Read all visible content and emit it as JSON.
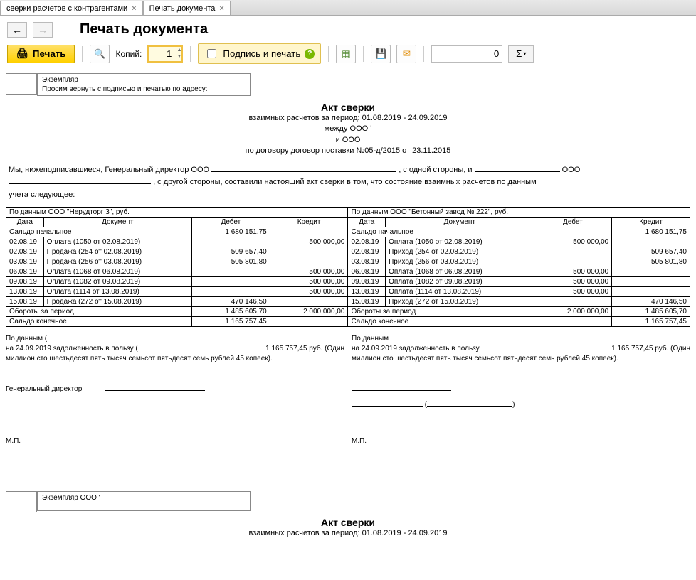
{
  "tabs": [
    {
      "label": "сверки расчетов с контрагентами"
    },
    {
      "label": "Печать документа"
    }
  ],
  "page_title": "Печать документа",
  "toolbar": {
    "print_label": "Печать",
    "copies_label": "Копий:",
    "copies_value": "1",
    "sign_print_label": "Подпись и печать",
    "number_value": "0"
  },
  "small_box": {
    "line1": "Экземпляр",
    "line2": "Просим вернуть с подписью и печатью по адресу:"
  },
  "doc": {
    "title": "Акт сверки",
    "period": "взаимных расчетов за период: 01.08.2019 - 24.09.2019",
    "between": "между ООО '",
    "and": "и ООО",
    "contract": "по договору договор поставки №05-д/2015 от 23.11.2015"
  },
  "intro": {
    "t1": "Мы, нижеподписавшиеся, Генеральный директор ООО",
    "t2": ", с одной стороны, и ",
    "t3": " ООО",
    "t4": ", с другой стороны, составили настоящий акт сверки в том, что состояние взаимных расчетов по данным",
    "t5": "учета следующее:"
  },
  "table": {
    "left_header": "По данным ООО \"Нерудторг 3\", руб.",
    "right_header": "По данным ООО \"Бетонный завод № 222\", руб.",
    "cols": {
      "date": "Дата",
      "doc": "Документ",
      "debit": "Дебет",
      "credit": "Кредит"
    },
    "open": "Сальдо начальное",
    "open_val": "1 680 151,75",
    "rows_left": [
      {
        "d": "02.08.19",
        "doc": "Оплата (1050 от 02.08.2019)",
        "db": "",
        "cr": "500 000,00"
      },
      {
        "d": "02.08.19",
        "doc": "Продажа (254 от 02.08.2019)",
        "db": "509 657,40",
        "cr": ""
      },
      {
        "d": "03.08.19",
        "doc": "Продажа (256 от 03.08.2019)",
        "db": "505 801,80",
        "cr": ""
      },
      {
        "d": "06.08.19",
        "doc": "Оплата (1068 от 06.08.2019)",
        "db": "",
        "cr": "500 000,00"
      },
      {
        "d": "09.08.19",
        "doc": "Оплата (1082 от 09.08.2019)",
        "db": "",
        "cr": "500 000,00"
      },
      {
        "d": "13.08.19",
        "doc": "Оплата (1114 от 13.08.2019)",
        "db": "",
        "cr": "500 000,00"
      },
      {
        "d": "15.08.19",
        "doc": "Продажа (272 от 15.08.2019)",
        "db": "470 146,50",
        "cr": ""
      }
    ],
    "rows_right": [
      {
        "d": "02.08.19",
        "doc": "Оплата (1050 от 02.08.2019)",
        "db": "500 000,00",
        "cr": ""
      },
      {
        "d": "02.08.19",
        "doc": "Приход (254 от 02.08.2019)",
        "db": "",
        "cr": "509 657,40"
      },
      {
        "d": "03.08.19",
        "doc": "Приход (256 от 03.08.2019)",
        "db": "",
        "cr": "505 801,80"
      },
      {
        "d": "06.08.19",
        "doc": "Оплата (1068 от 06.08.2019)",
        "db": "500 000,00",
        "cr": ""
      },
      {
        "d": "09.08.19",
        "doc": "Оплата (1082 от 09.08.2019)",
        "db": "500 000,00",
        "cr": ""
      },
      {
        "d": "13.08.19",
        "doc": "Оплата (1114 от 13.08.2019)",
        "db": "500 000,00",
        "cr": ""
      },
      {
        "d": "15.08.19",
        "doc": "Приход (272 от 15.08.2019)",
        "db": "",
        "cr": "470 146,50"
      }
    ],
    "turnover": "Обороты за период",
    "turn_l_db": "1 485 605,70",
    "turn_l_cr": "2 000 000,00",
    "turn_r_db": "2 000 000,00",
    "turn_r_cr": "1 485 605,70",
    "close": "Сальдо конечное",
    "close_l": "1 165 757,45",
    "close_r": "1 165 757,45"
  },
  "foot": {
    "l1": "По данным (",
    "l2": "на 24.09.2019 задолженность в пользу (",
    "amount": "1 165 757,45 руб. (Один",
    "words": "миллион сто шестьдесят пять тысяч семьсот пятьдесят семь рублей 45 копеек).",
    "r1": "По данным",
    "r2": "на 24.09.2019 задолженность в пользу",
    "gd": "Генеральный директор",
    "mp": "М.П."
  },
  "copy2": {
    "ex": "Экземпляр ООО '",
    "title": "Акт сверки",
    "period": "взаимных расчетов за период: 01.08.2019 - 24.09.2019"
  }
}
